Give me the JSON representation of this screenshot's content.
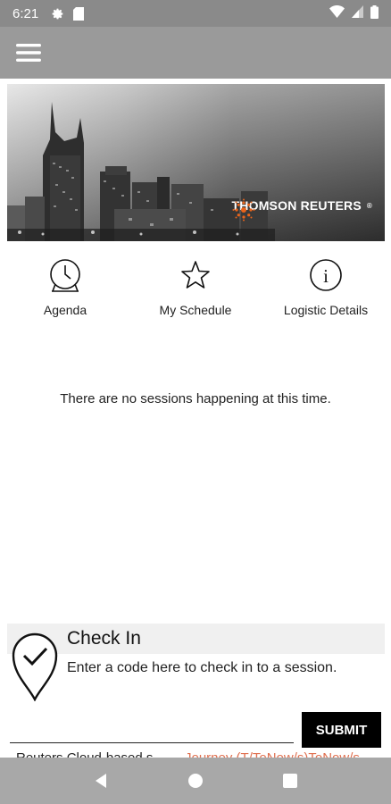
{
  "status_bar": {
    "time": "6:21",
    "icons": [
      "gear-icon",
      "sd-card-icon",
      "wifi-icon",
      "signal-icon",
      "battery-icon"
    ]
  },
  "toolbar": {
    "menu_icon": "hamburger-menu-icon"
  },
  "banner": {
    "brand_name": "THOMSON REUTERS",
    "trademark": "®"
  },
  "nav": {
    "items": [
      {
        "label": "Agenda",
        "icon": "clock-icon"
      },
      {
        "label": "My Schedule",
        "icon": "star-icon"
      },
      {
        "label": "Logistic Details",
        "icon": "info-icon"
      }
    ]
  },
  "main": {
    "empty_message": "There are no sessions happening at this time."
  },
  "checkin": {
    "title": "Check In",
    "subtitle": "Enter a code here to check in to a session.",
    "input_value": "",
    "input_placeholder": "",
    "submit_label": "SUBMIT",
    "icon": "check-pin-icon"
  },
  "background_text": {
    "left": "Reuters Cloud-based s",
    "right": "Journey (T/ToNow/s)ToNow/s"
  },
  "system_nav": {
    "icons": [
      "back-icon",
      "home-icon",
      "recents-icon"
    ]
  },
  "colors": {
    "status_bar": "#8a8a8a",
    "toolbar": "#9a9a9a",
    "brand_accent": "#e8641b",
    "submit_bg": "#000000",
    "system_nav": "#a8a8a8"
  }
}
